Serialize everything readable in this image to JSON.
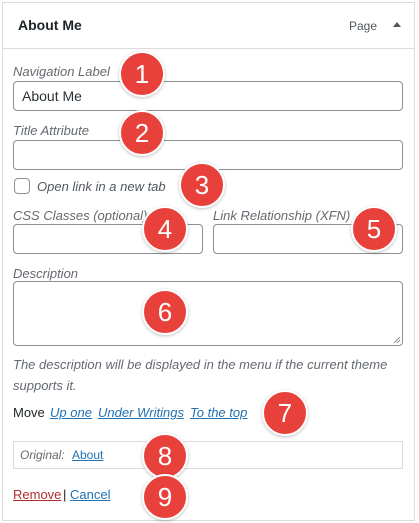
{
  "header": {
    "title": "About Me",
    "item_type": "Page"
  },
  "fields": {
    "navigation_label": {
      "label": "Navigation Label",
      "value": "About Me"
    },
    "title_attribute": {
      "label": "Title Attribute",
      "value": ""
    },
    "open_new_tab": {
      "label": "Open link in a new tab",
      "checked": false
    },
    "css_classes": {
      "label": "CSS Classes (optional)",
      "value": ""
    },
    "link_relationship": {
      "label": "Link Relationship (XFN)",
      "value": ""
    },
    "description": {
      "label": "Description",
      "value": "",
      "help": "The description will be displayed in the menu if the current theme supports it."
    }
  },
  "move": {
    "label": "Move",
    "links": [
      "Up one",
      "Under Writings",
      "To the top"
    ]
  },
  "original": {
    "label": "Original:",
    "link": "About"
  },
  "actions": {
    "remove": "Remove",
    "separator": "|",
    "cancel": "Cancel"
  },
  "badges": [
    "1",
    "2",
    "3",
    "4",
    "5",
    "6",
    "7",
    "8",
    "9"
  ],
  "colors": {
    "badge": "#e8403a",
    "link": "#2271b1",
    "remove": "#b32d2e"
  }
}
